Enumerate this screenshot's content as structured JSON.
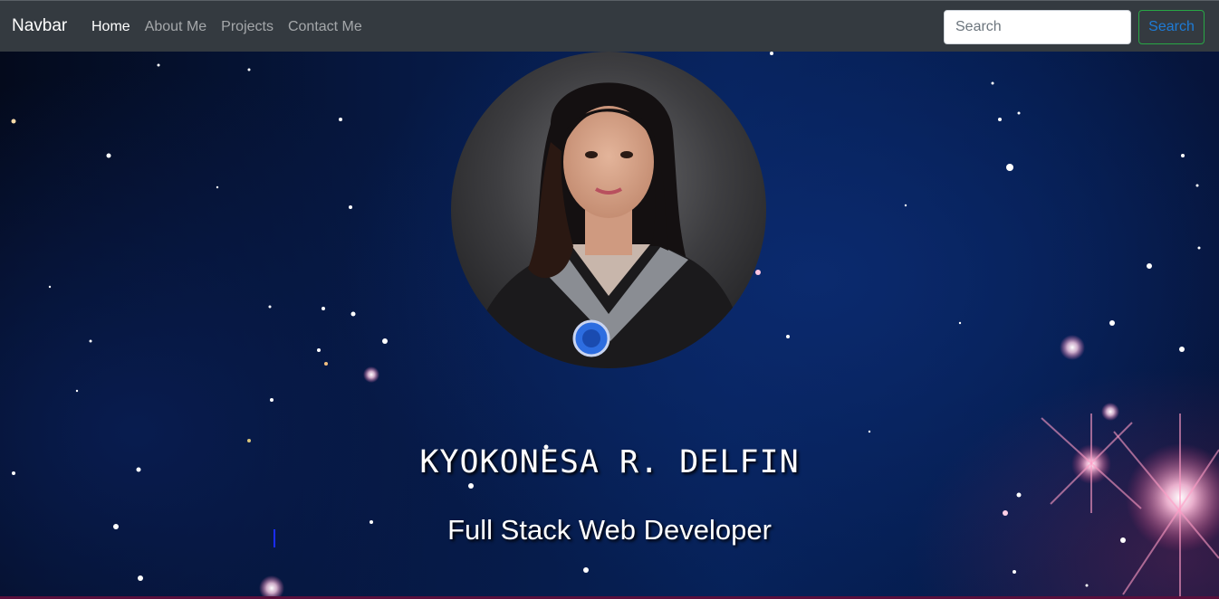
{
  "navbar": {
    "brand": "Navbar",
    "links": [
      {
        "label": "Home",
        "active": true
      },
      {
        "label": "About Me",
        "active": false
      },
      {
        "label": "Projects",
        "active": false
      },
      {
        "label": "Contact Me",
        "active": false
      }
    ],
    "search": {
      "placeholder": "Search",
      "value": "",
      "button_label": "Search"
    }
  },
  "hero": {
    "name": "KYOKONESA R. DELFIN",
    "title": "Full Stack Web Developer",
    "avatar_icon": "graduation-portrait-photo"
  },
  "colors": {
    "navbar_bg": "#343a40",
    "search_button_border": "#28a745",
    "search_button_text": "#1e7bd6",
    "hero_bg": "#061944"
  }
}
